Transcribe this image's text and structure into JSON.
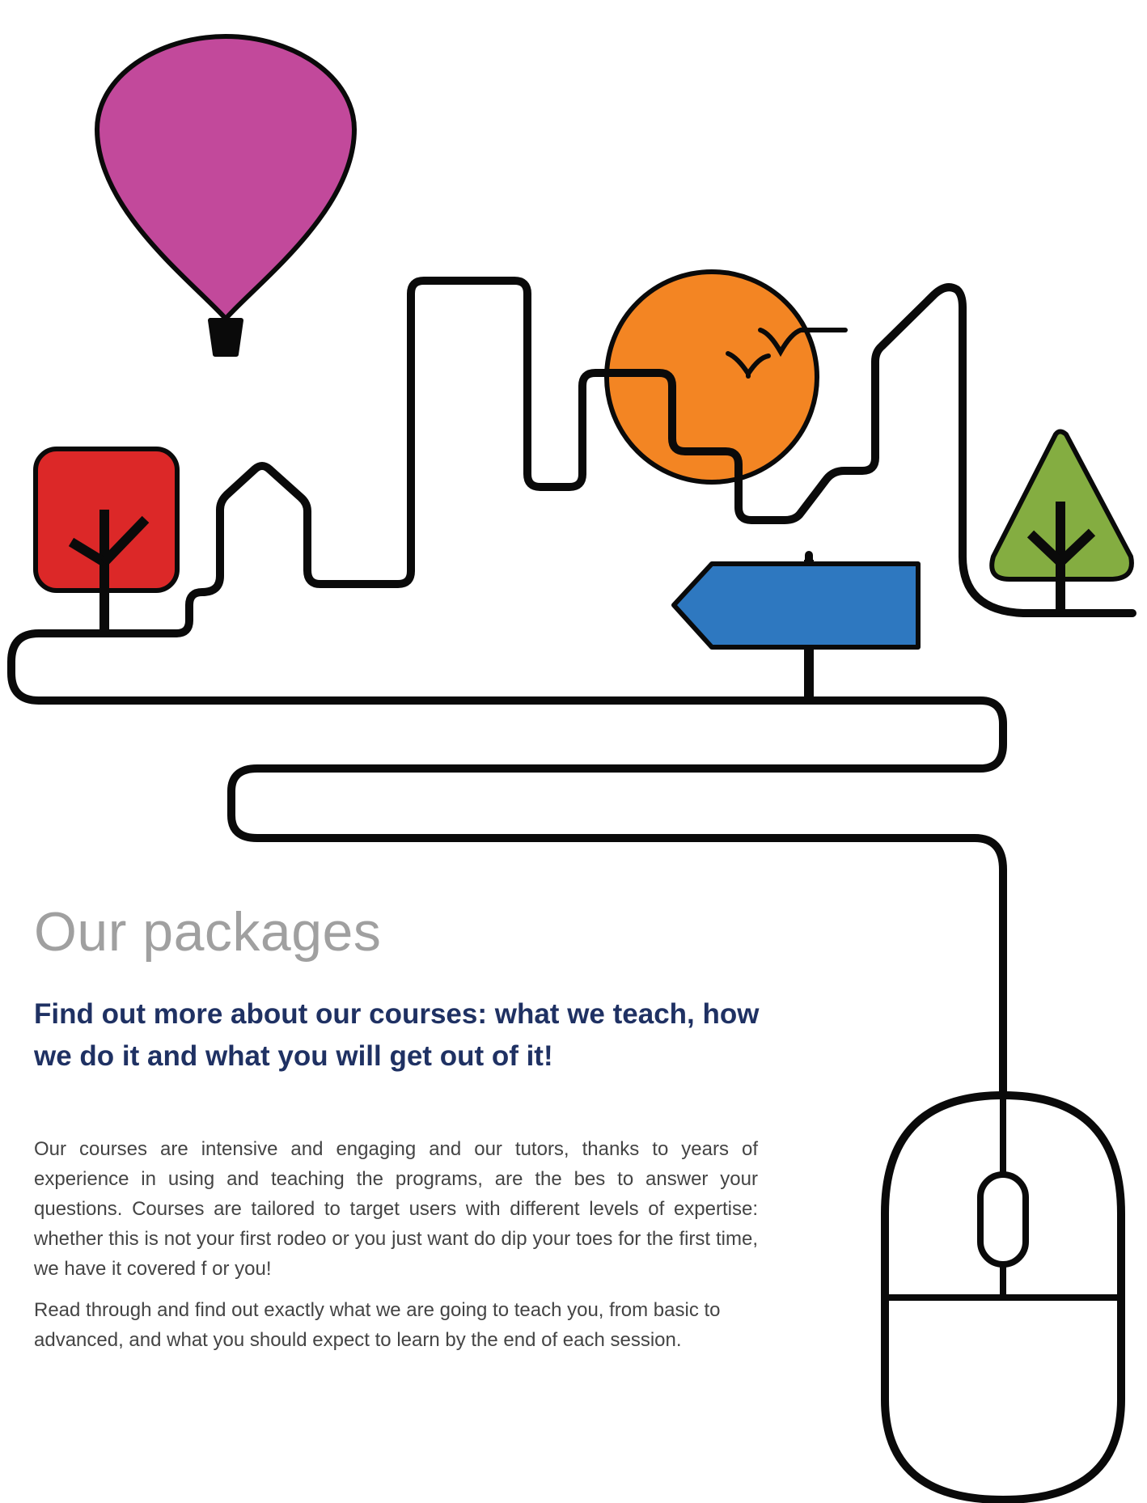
{
  "page": {
    "title": "Our packages",
    "subtitle": "Find out more about our courses: what we teach, how we do it and what you will get out of it!",
    "paragraphs": [
      "Our courses are intensive and engaging and our tutors, thanks to years of experience in  using and teaching the programs, are the bes to answer your questions. Courses are tailored to target users with different levels of expertise: whether this is not your first rodeo or you just want do dip your toes for the first time, we have it covered f or you!",
      "Read through and find out exactly what we are going to teach you, from basic to advanced, and what you should expect to learn by the end of each session."
    ]
  },
  "illustration": {
    "line_color": "#0a0a0a",
    "balloon_color": "#c2499b",
    "sun_color": "#f38523",
    "red_tree_color": "#dc2828",
    "green_tree_color": "#84ad41",
    "signpost_color": "#2e78c0"
  }
}
